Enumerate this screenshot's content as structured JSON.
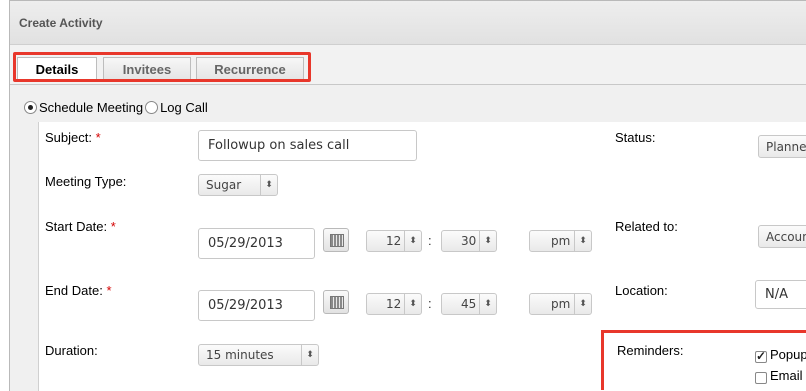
{
  "panel": {
    "title": "Create Activity"
  },
  "tabs": [
    {
      "label": "Details",
      "active": true
    },
    {
      "label": "Invitees",
      "active": false
    },
    {
      "label": "Recurrence",
      "active": false
    }
  ],
  "mode": {
    "options": [
      {
        "label": "Schedule Meeting",
        "selected": true
      },
      {
        "label": "Log Call",
        "selected": false
      }
    ]
  },
  "form": {
    "required_mark": "*",
    "subject": {
      "label": "Subject:",
      "value": "Followup on sales call"
    },
    "status": {
      "label": "Status:",
      "value": "Planned"
    },
    "meeting_type": {
      "label": "Meeting Type:",
      "value": "Sugar"
    },
    "start_date": {
      "label": "Start Date:",
      "date": "05/29/2013",
      "hour": "12",
      "minute": "30",
      "ampm": "pm"
    },
    "related_to": {
      "label": "Related to:",
      "value": "Account"
    },
    "end_date": {
      "label": "End Date:",
      "date": "05/29/2013",
      "hour": "12",
      "minute": "45",
      "ampm": "pm"
    },
    "location": {
      "label": "Location:",
      "value": "N/A"
    },
    "duration": {
      "label": "Duration:",
      "value": "15 minutes"
    },
    "reminders": {
      "label": "Reminders:",
      "options": [
        {
          "label": "Popup",
          "checked": true
        },
        {
          "label": "Email",
          "checked": false
        }
      ]
    },
    "time_separator": ":",
    "select_arrows": "▲▼"
  },
  "colors": {
    "highlight": "#e8372b",
    "required": "#d40000"
  }
}
